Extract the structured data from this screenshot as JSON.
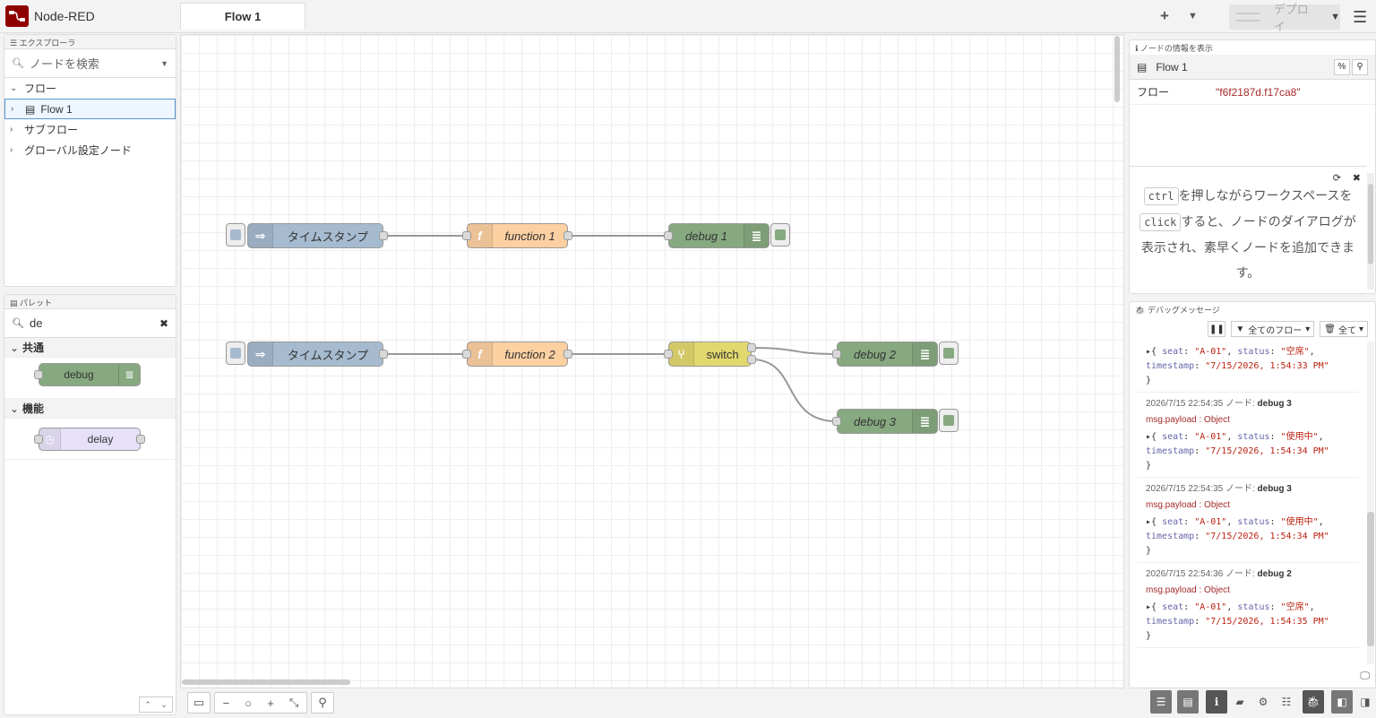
{
  "header": {
    "app_title": "Node-RED",
    "tab_label": "Flow 1",
    "deploy_label": "デプロイ"
  },
  "explorer": {
    "title": "エクスプローラ",
    "search_placeholder": "ノードを検索",
    "items": [
      {
        "label": "フロー"
      },
      {
        "label": "Flow 1"
      },
      {
        "label": "サブフロー"
      },
      {
        "label": "グローバル設定ノード"
      }
    ]
  },
  "palette": {
    "title": "パレット",
    "search_value": "de",
    "categories": [
      {
        "label": "共通",
        "node": "debug"
      },
      {
        "label": "機能",
        "node": "delay"
      }
    ]
  },
  "flow": {
    "nodes": {
      "inject1": "タイムスタンプ",
      "function1": "function 1",
      "debug1": "debug 1",
      "inject2": "タイムスタンプ",
      "function2": "function 2",
      "switch": "switch",
      "debug2": "debug 2",
      "debug3": "debug 3"
    }
  },
  "info": {
    "title": "ノードの情報を表示",
    "flow_name": "Flow 1",
    "key": "フロー",
    "value": "\"f6f2187d.f17ca8\"",
    "help_part1": "を押しながらワークスペースを",
    "help_key1": "ctrl",
    "help_key2": "click",
    "help_part2": "すると、ノードのダイアログが表示され、素早くノードを追加できます。"
  },
  "debug": {
    "title": "デバッグメッセージ",
    "filter_label": "全てのフロー",
    "clear_label": "全て",
    "messages": [
      {
        "header": "",
        "node": "",
        "type": "",
        "seat": "\"A-01\"",
        "status": "\"空席\"",
        "timestamp": "\"7/15/2026, 1:54:33 PM\""
      },
      {
        "header": "2026/7/15 22:54:35 ノード:",
        "node": "debug 3",
        "type": "msg.payload : Object",
        "seat": "\"A-01\"",
        "status": "\"使用中\"",
        "timestamp": "\"7/15/2026, 1:54:34 PM\""
      },
      {
        "header": "2026/7/15 22:54:35 ノード:",
        "node": "debug 3",
        "type": "msg.payload : Object",
        "seat": "\"A-01\"",
        "status": "\"使用中\"",
        "timestamp": "\"7/15/2026, 1:54:34 PM\""
      },
      {
        "header": "2026/7/15 22:54:36 ノード:",
        "node": "debug 2",
        "type": "msg.payload : Object",
        "seat": "\"A-01\"",
        "status": "\"空席\"",
        "timestamp": "\"7/15/2026, 1:54:35 PM\""
      }
    ]
  }
}
